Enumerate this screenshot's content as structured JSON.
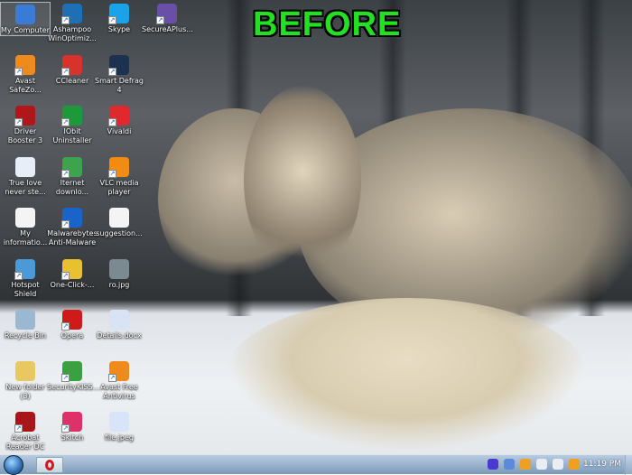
{
  "banner": "BEFORE",
  "icons": [
    {
      "label": "My Computer",
      "color": "#3a7bd5",
      "selected": true
    },
    {
      "label": "Ashampoo WinOptimiz...",
      "color": "#1f6fb5"
    },
    {
      "label": "Skype",
      "color": "#1aa3e8"
    },
    {
      "label": "SecureAPlus...",
      "color": "#6a4fa8"
    },
    {
      "label": "Avast SafeZo...",
      "color": "#f08a1c"
    },
    {
      "label": "CCleaner",
      "color": "#d9312b"
    },
    {
      "label": "Smart Defrag 4",
      "color": "#1c3250"
    },
    {
      "label": "Driver Booster 3",
      "color": "#b0161a"
    },
    {
      "label": "IObit Uninstaller",
      "color": "#1c9a3a"
    },
    {
      "label": "Vivaldi",
      "color": "#e0282f"
    },
    {
      "label": "True love never ste...",
      "color": "#e8eef8"
    },
    {
      "label": "Iternet downlo...",
      "color": "#3fa34d"
    },
    {
      "label": "VLC media player",
      "color": "#f28c10"
    },
    {
      "label": "My informatio...",
      "color": "#f4f4f4"
    },
    {
      "label": "Malwarebytes Anti-Malware",
      "color": "#1a64c8"
    },
    {
      "label": "suggestion...",
      "color": "#f4f4f4"
    },
    {
      "label": "Hotspot Shield",
      "color": "#4a9ad8"
    },
    {
      "label": "One-Click-...",
      "color": "#e8c030"
    },
    {
      "label": "ro.jpg",
      "color": "#7a8a90"
    },
    {
      "label": "Recycle Bin",
      "color": "#9ab8d0"
    },
    {
      "label": "Opera",
      "color": "#d01a1a"
    },
    {
      "label": "Details.docx",
      "color": "#d8e4f4"
    },
    {
      "label": "New folder (3)",
      "color": "#e8c860"
    },
    {
      "label": "SecurityKISS...",
      "color": "#3aa040"
    },
    {
      "label": "Avast Free Antivirus",
      "color": "#f08a1c"
    },
    {
      "label": "Acrobat Reader DC",
      "color": "#a8161a"
    },
    {
      "label": "Skitch",
      "color": "#e0306a"
    },
    {
      "label": "file.jpeg",
      "color": "#d8e4f8"
    }
  ],
  "taskbar": {
    "clock": "11:19 PM",
    "tray": [
      {
        "name": "network-app",
        "color": "#4a3ad0"
      },
      {
        "name": "app",
        "color": "#5a8ad8"
      },
      {
        "name": "app2",
        "color": "#f0a020"
      },
      {
        "name": "volume",
        "color": "#e8eef4"
      },
      {
        "name": "display",
        "color": "#e8eef4"
      },
      {
        "name": "app3",
        "color": "#f0a020"
      }
    ]
  }
}
